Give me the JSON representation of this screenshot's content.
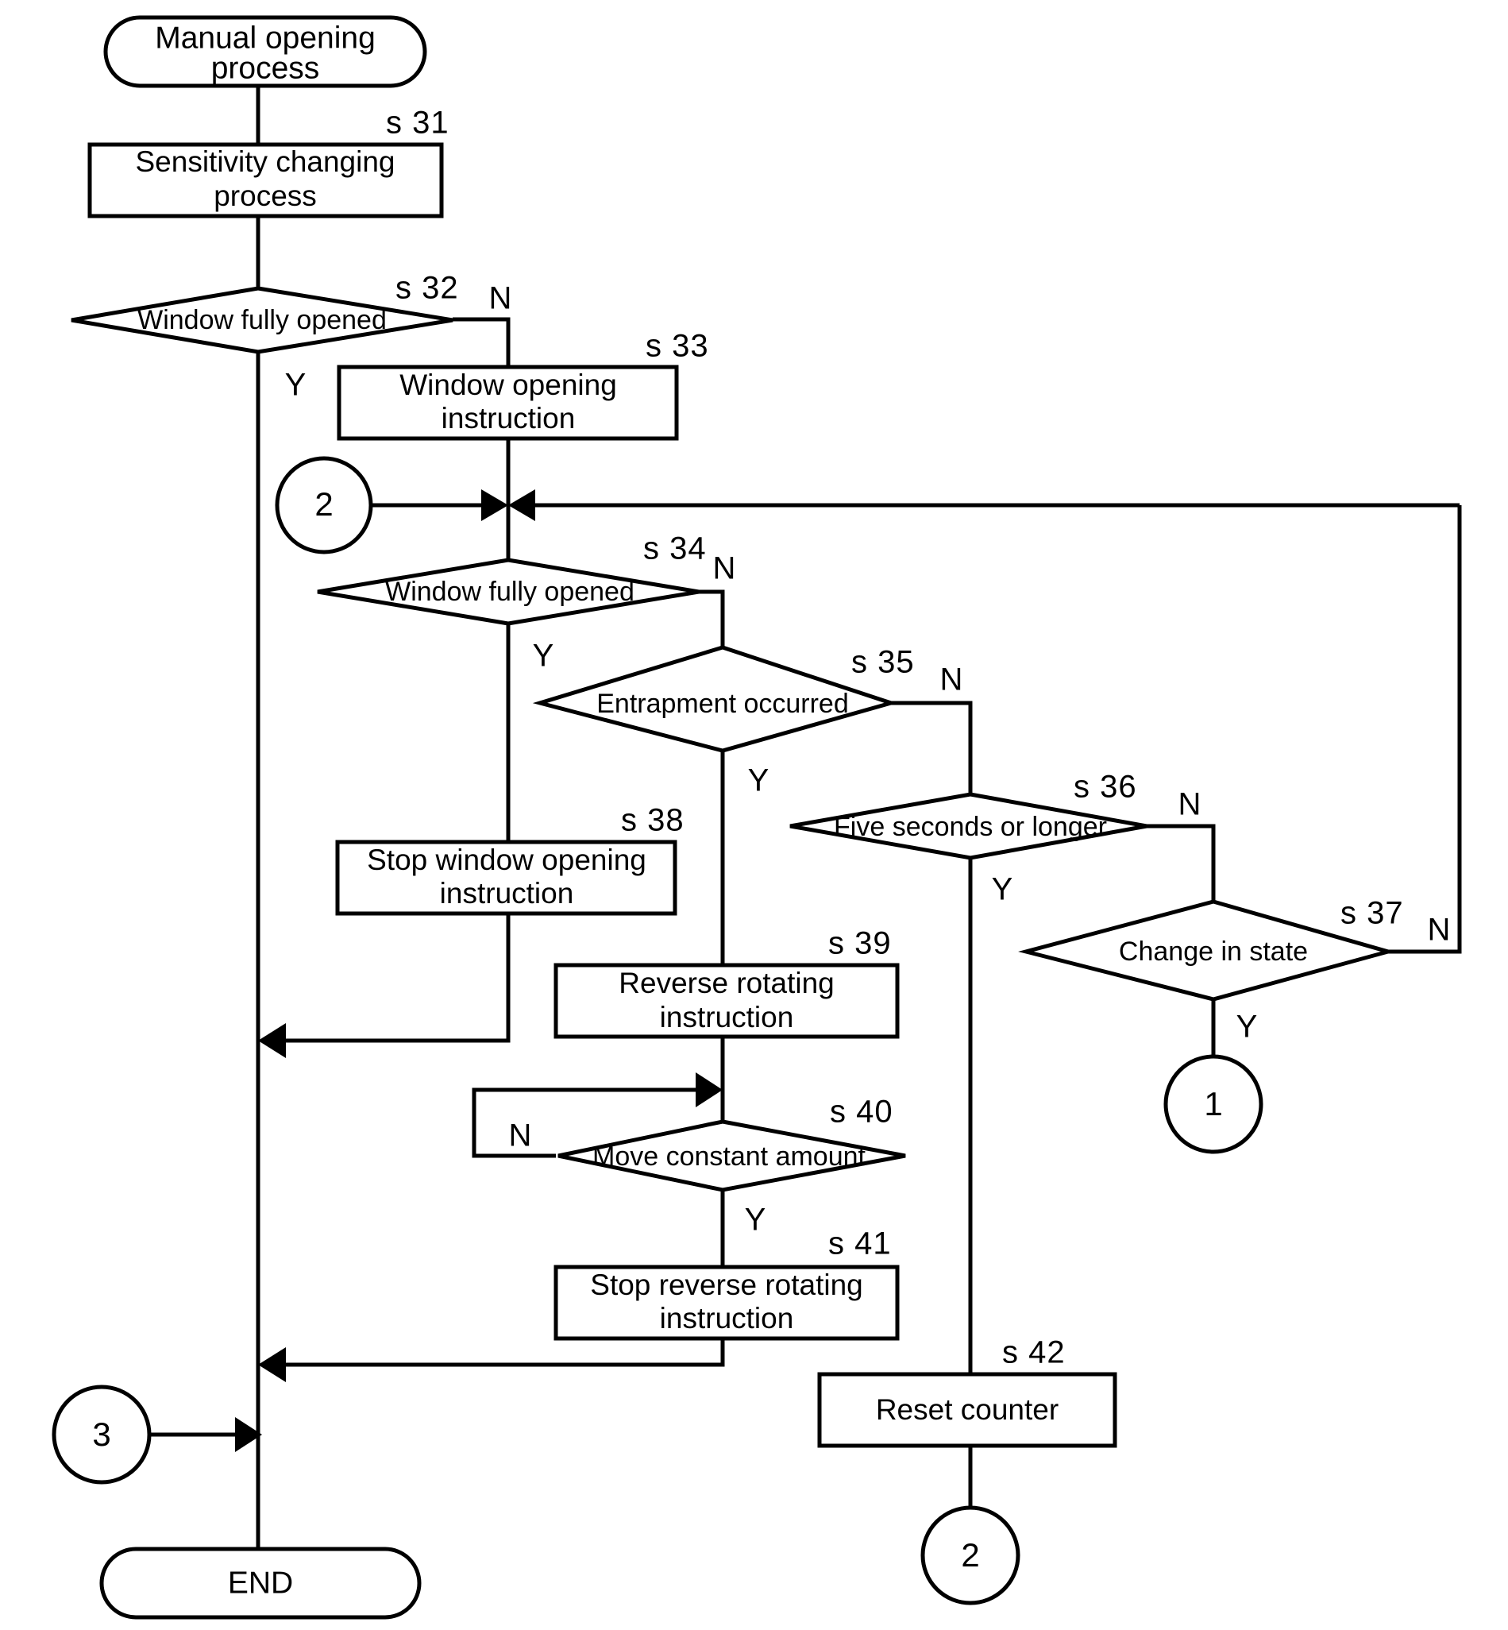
{
  "diagram": {
    "title": "Manual opening process flowchart",
    "background_color": "#ffffff",
    "line_color": "#000000"
  },
  "terminators": {
    "start_line1": "Manual opening",
    "start_line2": "process",
    "end": "END"
  },
  "processes": [
    {
      "id": "s31",
      "step": "s 31",
      "line1": "Sensitivity changing",
      "line2": "process"
    },
    {
      "id": "s33",
      "step": "s 33",
      "line1": "Window opening",
      "line2": "instruction"
    },
    {
      "id": "s38",
      "step": "s 38",
      "line1": "Stop window opening",
      "line2": "instruction"
    },
    {
      "id": "s39",
      "step": "s 39",
      "line1": "Reverse rotating",
      "line2": "instruction"
    },
    {
      "id": "s41",
      "step": "s 41",
      "line1": "Stop reverse rotating",
      "line2": "instruction"
    },
    {
      "id": "s42",
      "step": "s 42",
      "line1": "Reset counter",
      "line2": ""
    }
  ],
  "decisions": [
    {
      "id": "s32",
      "step": "s 32",
      "label": "Window fully opened",
      "yes": "Y",
      "no": "N"
    },
    {
      "id": "s34",
      "step": "s 34",
      "label": "Window fully opened",
      "yes": "Y",
      "no": "N"
    },
    {
      "id": "s35",
      "step": "s 35",
      "label": "Entrapment occurred",
      "yes": "Y",
      "no": "N"
    },
    {
      "id": "s36",
      "step": "s 36",
      "label": "Five seconds or longer",
      "yes": "Y",
      "no": "N"
    },
    {
      "id": "s37",
      "step": "s 37",
      "label": "Change in state",
      "yes": "Y",
      "no": "N"
    },
    {
      "id": "s40",
      "step": "s 40",
      "label": "Move constant amount",
      "yes": "Y",
      "no": "N"
    }
  ],
  "connectors": [
    {
      "id": "conn-2-in",
      "label": "2"
    },
    {
      "id": "conn-1-out",
      "label": "1"
    },
    {
      "id": "conn-3-in",
      "label": "3"
    },
    {
      "id": "conn-2-out",
      "label": "2"
    }
  ]
}
